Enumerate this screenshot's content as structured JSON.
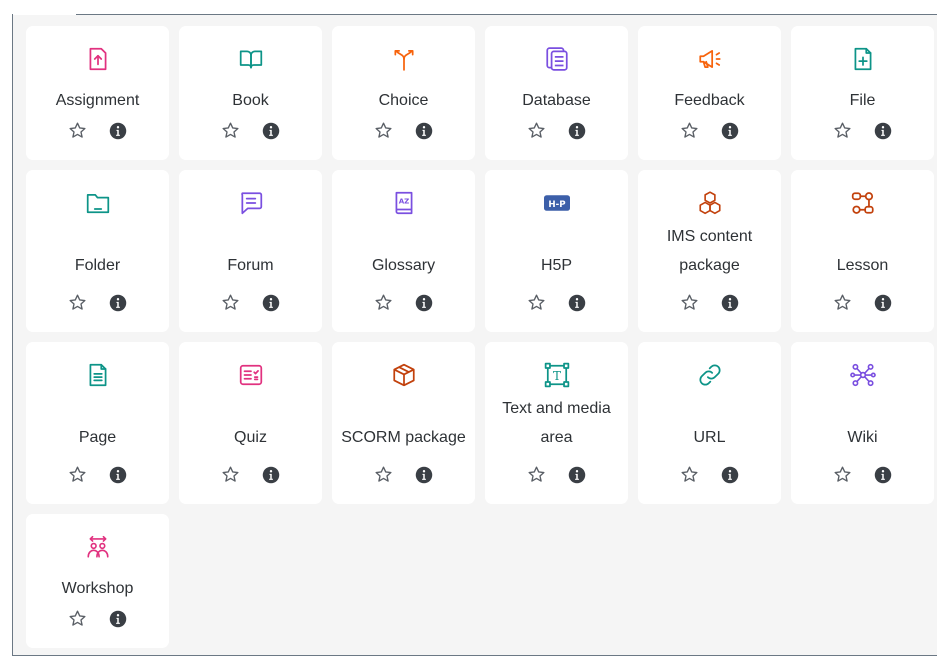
{
  "colors": {
    "pink": "#e1317f",
    "teal": "#0d9488",
    "orange": "#f7630c",
    "purple": "#7a4fe0",
    "blue": "#3c5fa9",
    "brown": "#c2410c",
    "star": "#5a5f66",
    "info": "#3a3f45"
  },
  "activities": [
    {
      "key": "assignment",
      "label": "Assignment",
      "icon": "assignment-icon"
    },
    {
      "key": "book",
      "label": "Book",
      "icon": "book-icon"
    },
    {
      "key": "choice",
      "label": "Choice",
      "icon": "choice-icon"
    },
    {
      "key": "database",
      "label": "Database",
      "icon": "database-icon"
    },
    {
      "key": "feedback",
      "label": "Feedback",
      "icon": "feedback-icon"
    },
    {
      "key": "file",
      "label": "File",
      "icon": "file-icon"
    },
    {
      "key": "folder",
      "label": "Folder",
      "icon": "folder-icon"
    },
    {
      "key": "forum",
      "label": "Forum",
      "icon": "forum-icon"
    },
    {
      "key": "glossary",
      "label": "Glossary",
      "icon": "glossary-icon"
    },
    {
      "key": "h5p",
      "label": "H5P",
      "icon": "h5p-icon",
      "icon_text": "H-P"
    },
    {
      "key": "ims",
      "label": "IMS content package",
      "icon": "ims-package-icon"
    },
    {
      "key": "lesson",
      "label": "Lesson",
      "icon": "lesson-icon"
    },
    {
      "key": "page",
      "label": "Page",
      "icon": "page-icon"
    },
    {
      "key": "quiz",
      "label": "Quiz",
      "icon": "quiz-icon"
    },
    {
      "key": "scorm",
      "label": "SCORM package",
      "icon": "scorm-icon"
    },
    {
      "key": "textmedia",
      "label": "Text and media area",
      "icon": "text-media-icon",
      "icon_text": "T"
    },
    {
      "key": "url",
      "label": "URL",
      "icon": "url-link-icon"
    },
    {
      "key": "wiki",
      "label": "Wiki",
      "icon": "wiki-icon"
    },
    {
      "key": "workshop",
      "label": "Workshop",
      "icon": "workshop-icon"
    }
  ]
}
